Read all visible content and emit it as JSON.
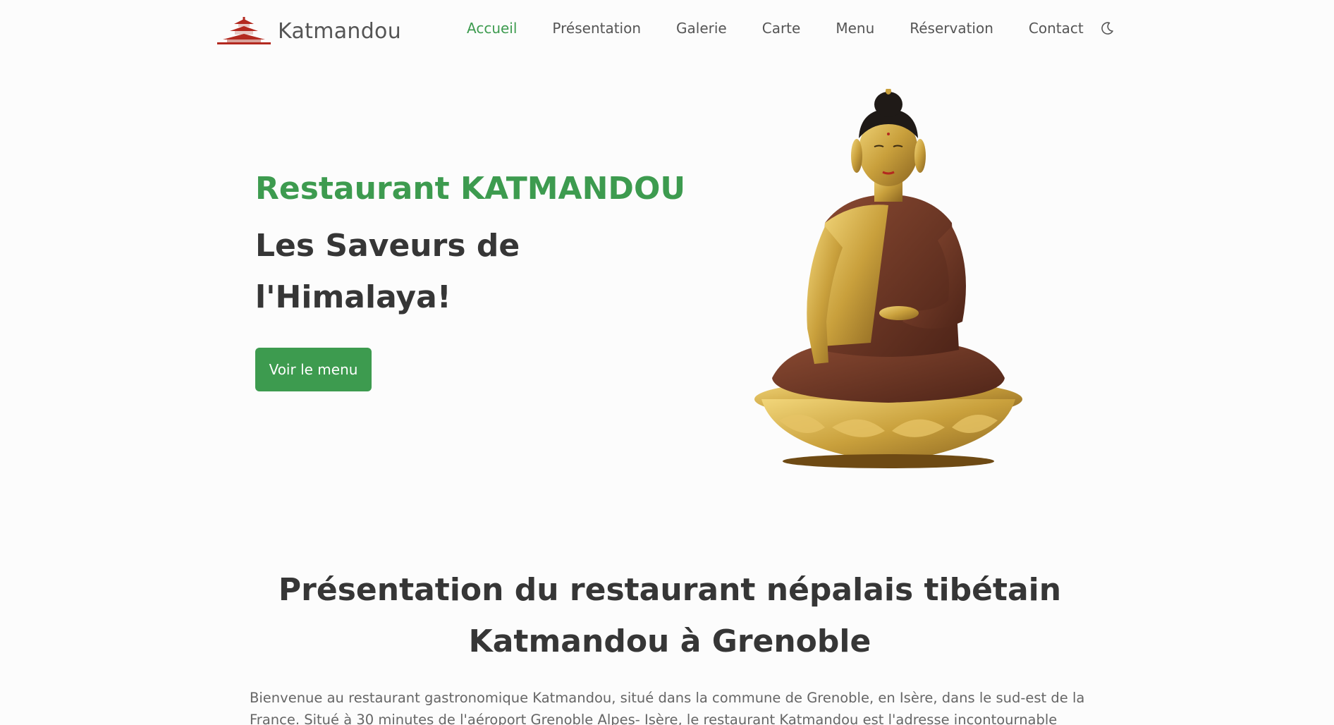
{
  "brand": {
    "name": "Katmandou"
  },
  "nav": {
    "items": [
      {
        "label": "Accueil",
        "active": true
      },
      {
        "label": "Présentation"
      },
      {
        "label": "Galerie"
      },
      {
        "label": "Carte"
      },
      {
        "label": "Menu"
      },
      {
        "label": "Réservation"
      },
      {
        "label": "Contact"
      }
    ]
  },
  "hero": {
    "title": "Restaurant KATMANDOU",
    "subtitle": "Les Saveurs de l'Himalaya!",
    "cta_label": "Voir le menu"
  },
  "presentation": {
    "title": "Présentation du restaurant népalais tibétain Katmandou à Grenoble",
    "body": "Bienvenue au restaurant gastronomique Katmandou, situé dans la commune de Grenoble, en Isère, dans le sud-est de la France. Situé à 30 minutes de l'aéroport Grenoble Alpes- Isère, le restaurant Katmandou est l'adresse incontournable"
  },
  "colors": {
    "accent": "#3d9b4f",
    "heading": "#363636",
    "logo_red": "#b3291f"
  },
  "icons": {
    "theme_toggle": "moon-icon",
    "logo": "pagoda-icon"
  }
}
